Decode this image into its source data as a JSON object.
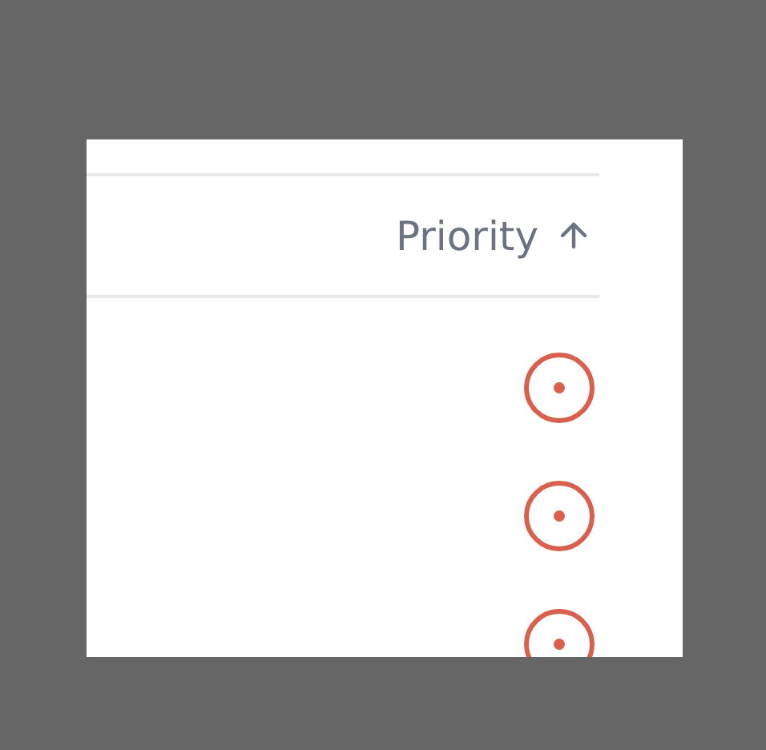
{
  "table": {
    "columns": [
      {
        "label": "Priority",
        "sorted": true
      }
    ],
    "rows": [
      {
        "kind": "target"
      },
      {
        "kind": "target"
      },
      {
        "kind": "target"
      }
    ]
  }
}
